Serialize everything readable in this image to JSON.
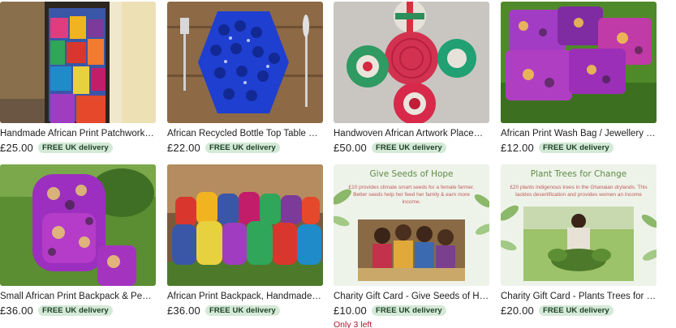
{
  "currency_symbol": "£",
  "delivery_badge": "FREE UK delivery",
  "products": [
    {
      "title": "Handmade African Print Patchwork Apr...",
      "price": "£25.00",
      "badge": "FREE UK delivery",
      "image": "patchwork-apron-photo"
    },
    {
      "title": "African Recycled Bottle Top Table Mats,...",
      "price": "£22.00",
      "badge": "FREE UK delivery",
      "image": "bottle-top-mat-photo"
    },
    {
      "title": "Handwoven African Artwork Placemats ...",
      "price": "£50.00",
      "badge": "FREE UK delivery",
      "image": "woven-placemats-photo"
    },
    {
      "title": "African Print Wash Bag / Jewellery Bag ...",
      "price": "£12.00",
      "badge": "FREE UK delivery",
      "image": "wash-bags-photo"
    },
    {
      "title": "Small African Print Backpack & Pencil C...",
      "price": "£36.00",
      "badge": "FREE UK delivery",
      "image": "backpack-pencil-case-photo"
    },
    {
      "title": "African Print Backpack, Handmade in U...",
      "price": "£36.00",
      "badge": "FREE UK delivery",
      "image": "backpacks-group-photo"
    },
    {
      "title": "Charity Gift Card - Give Seeds of Hope ...",
      "price": "£10.00",
      "badge": "FREE UK delivery",
      "stock": "Only 3 left",
      "image": "seeds-of-hope-card",
      "card_heading": "Give Seeds of Hope",
      "card_text": "£10 provides climate smart seeds for a female farmer. Better seeds help her feed her family & earn more income."
    },
    {
      "title": "Charity Gift Card - Plants Trees for Cha...",
      "price": "£20.00",
      "badge": "FREE UK delivery",
      "image": "plant-trees-card",
      "card_heading": "Plant Trees for Change",
      "card_text": "£20 plants indigenous trees in the Ghanaian drylands. This tackles desertification and provides women an income"
    }
  ],
  "colors": {
    "badge_bg": "#d4e9d7",
    "badge_text": "#1d3f25",
    "stock_text": "#a61a2e"
  }
}
